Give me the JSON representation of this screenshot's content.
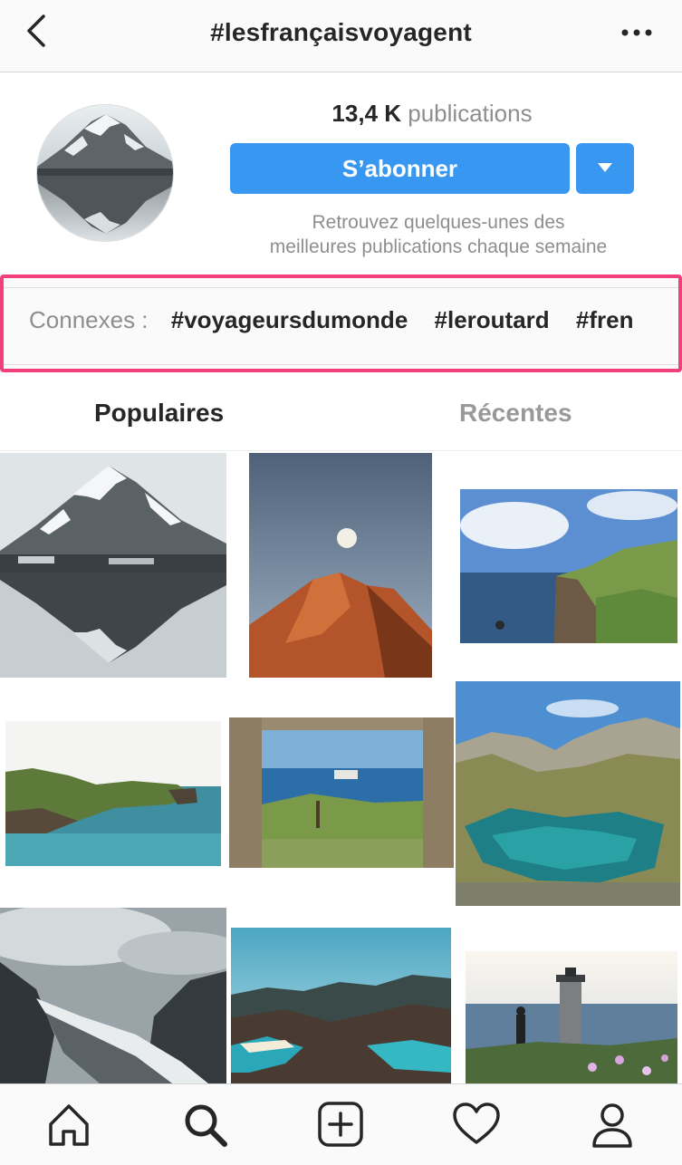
{
  "header": {
    "title": "#lesfrançaisvoyagent",
    "back_icon": "chevron-left-icon",
    "more_icon": "more-horizontal-icon"
  },
  "profile": {
    "count_value": "13,4 K",
    "count_label": "publications",
    "follow_label": "S’abonner",
    "dropdown_icon": "triangle-down-icon",
    "description_line1": "Retrouvez quelques-unes des",
    "description_line2": "meilleures publications chaque semaine"
  },
  "related": {
    "label": "Connexes :",
    "tags": [
      "#voyageursdumonde",
      "#leroutard",
      "#fren"
    ],
    "highlight_color": "#f43f7d"
  },
  "tabs": {
    "popular": "Populaires",
    "recent": "Récentes"
  },
  "grid": {
    "images": [
      "snowy-mountain-reflection-photo",
      "moon-over-red-peak-photo",
      "sea-cliff-photo",
      "green-coastline-photo",
      "stone-window-sea-view-photo",
      "mountain-lake-photo",
      "glacier-valley-photo",
      "tropical-islands-photo",
      "lighthouse-coast-photo"
    ]
  },
  "bottom_nav": {
    "icons": [
      "home-icon",
      "search-icon",
      "add-post-icon",
      "heart-icon",
      "profile-icon"
    ]
  },
  "colors": {
    "accent": "#3897f0",
    "muted_text": "#8e8e8e",
    "primary_text": "#262626"
  }
}
